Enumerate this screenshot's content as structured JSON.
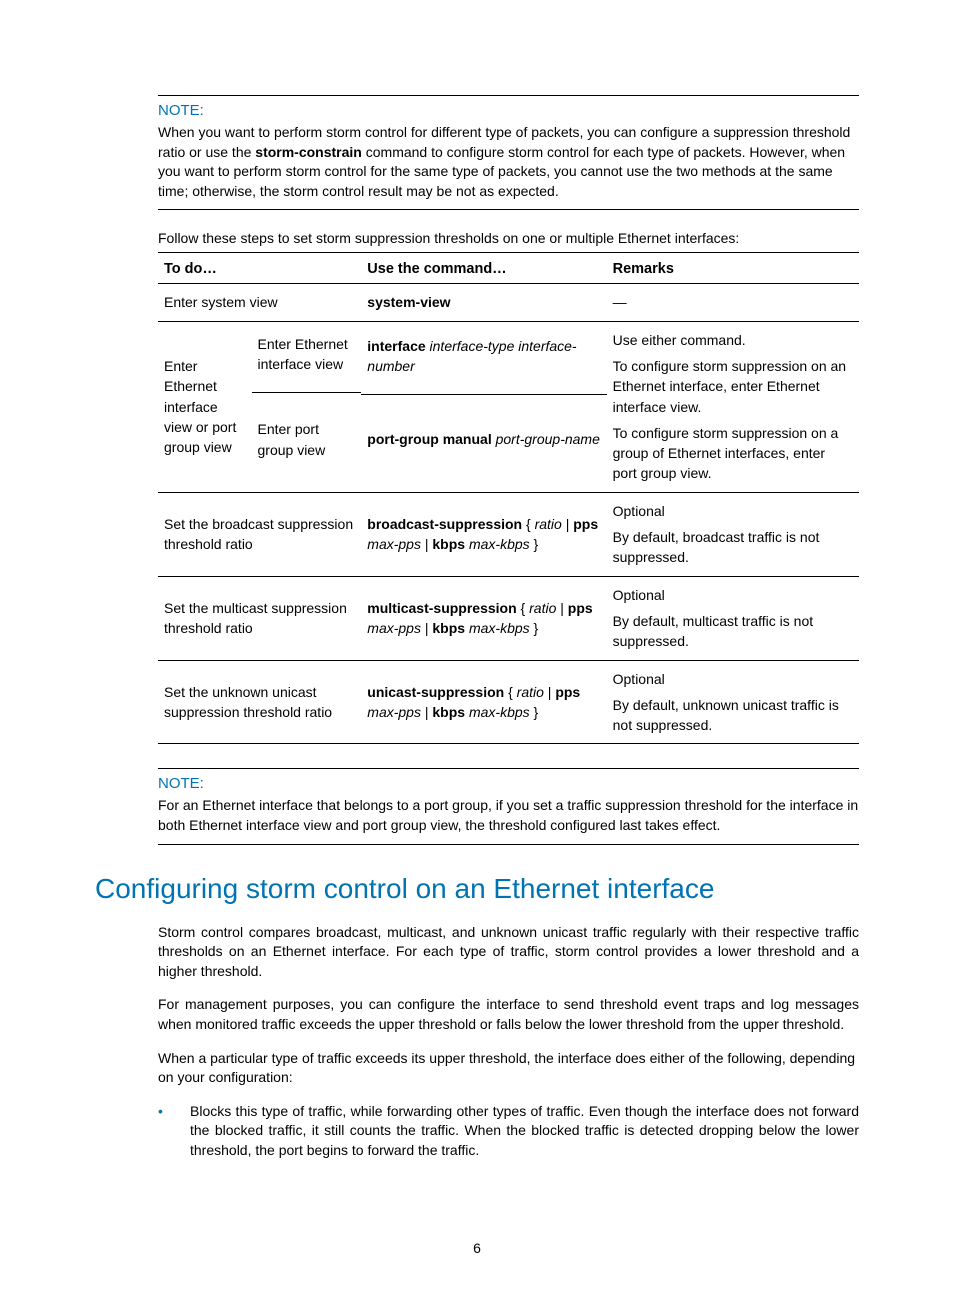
{
  "note1": {
    "title": "NOTE:",
    "body_1": "When you want to perform storm control for different type of packets, you can configure a suppression threshold ratio or use the ",
    "body_bold": "storm-constrain",
    "body_2": " command to configure storm control for each type of packets. However, when you want to perform storm control for the same type of packets, you cannot use the two methods at the same time; otherwise, the storm control result may be not as expected."
  },
  "intro": "Follow these steps to set storm suppression thresholds on one or multiple Ethernet interfaces:",
  "table": {
    "headers": [
      "To do…",
      "Use the command…",
      "Remarks"
    ],
    "row1": {
      "todo": "Enter system view",
      "cmd": "system-view",
      "rem": "—"
    },
    "row2": {
      "todo_outer": "Enter Ethernet interface view or port group view",
      "sub1": {
        "todo": "Enter Ethernet interface view",
        "cmd_b": "interface",
        "cmd_i1": " interface-type interface-number"
      },
      "sub2": {
        "todo": "Enter port group view",
        "cmd_b": "port-group manual",
        "cmd_i": " port-group-name"
      },
      "rem_1": "Use either command.",
      "rem_2": "To configure storm suppression on an Ethernet interface, enter Ethernet interface view.",
      "rem_3": "To configure storm suppression on a group of Ethernet interfaces, enter port group view."
    },
    "row3": {
      "todo": "Set the broadcast suppression threshold ratio",
      "cmd_b1": "broadcast-suppression",
      "cmd_t1": " { ",
      "cmd_i1": "ratio",
      "cmd_t2": " | ",
      "cmd_b2": "pps",
      "cmd_t3": " ",
      "cmd_i2": "max-pps",
      "cmd_t4": " | ",
      "cmd_b3": "kbps",
      "cmd_t5": " ",
      "cmd_i3": "max-kbps",
      "cmd_t6": " }",
      "rem_1": "Optional",
      "rem_2": "By default, broadcast traffic is not suppressed."
    },
    "row4": {
      "todo": "Set the multicast suppression threshold ratio",
      "cmd_b1": "multicast-suppression",
      "cmd_t1": " { ",
      "cmd_i1": "ratio",
      "cmd_t2": " | ",
      "cmd_b2": "pps",
      "cmd_t3": " ",
      "cmd_i2": "max-pps",
      "cmd_t4": " | ",
      "cmd_b3": "kbps",
      "cmd_t5": " ",
      "cmd_i3": "max-kbps",
      "cmd_t6": " }",
      "rem_1": "Optional",
      "rem_2": "By default, multicast traffic is not suppressed."
    },
    "row5": {
      "todo": "Set the unknown unicast suppression threshold ratio",
      "cmd_b1": "unicast-suppression",
      "cmd_t1": " { ",
      "cmd_i1": "ratio",
      "cmd_t2": " | ",
      "cmd_b2": "pps",
      "cmd_t3": " ",
      "cmd_i2": "max-pps",
      "cmd_t4": " | ",
      "cmd_b3": "kbps",
      "cmd_t5": " ",
      "cmd_i3": "max-kbps",
      "cmd_t6": " }",
      "rem_1": "Optional",
      "rem_2": "By default, unknown unicast traffic is not suppressed."
    }
  },
  "note2": {
    "title": "NOTE:",
    "body": "For an Ethernet interface that belongs to a port group, if you set a traffic suppression threshold for the interface in both Ethernet interface view and port group view, the threshold configured last takes effect."
  },
  "section_title": "Configuring storm control on an Ethernet interface",
  "para1": "Storm control compares broadcast, multicast, and unknown unicast traffic regularly with their respective traffic thresholds on an Ethernet interface. For each type of traffic, storm control provides a lower threshold and a higher threshold.",
  "para2": "For management purposes, you can configure the interface to send threshold event traps and log messages when monitored traffic exceeds the upper threshold or falls below the lower threshold from the upper threshold.",
  "para3": "When a particular type of traffic exceeds its upper threshold, the interface does either of the following, depending on your configuration:",
  "bullet1": "Blocks this type of traffic, while forwarding other types of traffic. Even though the interface does not forward the blocked traffic, it still counts the traffic. When the blocked traffic is detected dropping below the lower threshold, the port begins to forward the traffic.",
  "pagenum": "6"
}
